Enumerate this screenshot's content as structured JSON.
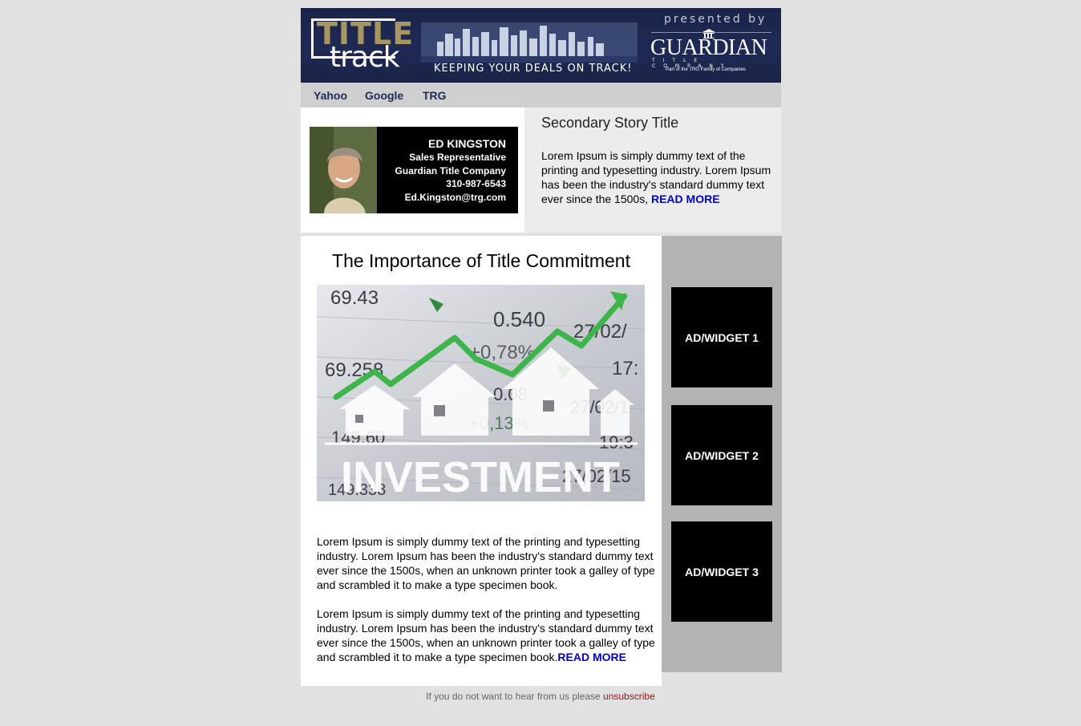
{
  "header": {
    "logo_title": "TITLE",
    "logo_track": "track",
    "tagline": "KEEPING YOUR DEALS ON TRACK!",
    "presented_by": "presented by",
    "sponsor": "GUARDIAN",
    "sponsor_sub": "TITLE COMPANY",
    "sponsor_family": "Part of the TRG Family of Companies"
  },
  "nav": {
    "items": [
      "Yahoo",
      "Google",
      "TRG"
    ]
  },
  "agent": {
    "name": "ED KINGSTON",
    "role": "Sales Representative",
    "company": "Guardian Title Company",
    "phone": "310-987-6543",
    "email": "Ed.Kingston@trg.com"
  },
  "secondary": {
    "title": "Secondary Story Title",
    "body": "Lorem Ipsum is simply dummy text of the printing and typesetting industry. Lorem Ipsum has been the industry's standard dummy text ever since the 1500s, ",
    "read_more": "READ MORE"
  },
  "main": {
    "title": "The Importance of Title Commitment",
    "image": {
      "caption": "INVESTMENT",
      "numbers": [
        "69.43",
        "0.540",
        "27/02/",
        "+0,78%",
        "69.258",
        "17:",
        "0.08",
        "27/02/1",
        "+0,13%",
        "149.60",
        "19:3",
        "27/02/15",
        "149.338"
      ]
    },
    "para1": "Lorem Ipsum is simply dummy text of the printing and typesetting industry. Lorem Ipsum has been the industry's standard dummy text ever since the 1500s, when an unknown printer took a galley of type and scrambled it to make a type specimen book.",
    "para2": "Lorem Ipsum is simply dummy text of the printing and typesetting industry. Lorem Ipsum has been the industry's standard dummy text ever since the 1500s, when an unknown printer took a galley of type and scrambled it to make a type specimen book.",
    "read_more": "READ MORE"
  },
  "sidebar": {
    "ads": [
      "AD/WIDGET 1",
      "AD/WIDGET 2",
      "AD/WIDGET 3"
    ]
  },
  "footer": {
    "text": "If you do not want to hear from us please ",
    "link": "unsubscribe"
  },
  "colors": {
    "banner": "#1f2a55",
    "link": "#0000cc",
    "sidebar": "#b4b3b3",
    "chart_arrow": "#3db54a"
  }
}
